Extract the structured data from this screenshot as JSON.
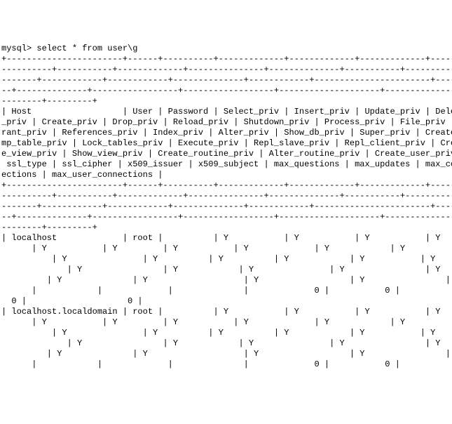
{
  "terminal": {
    "prompt": "mysql> ",
    "command": "select * from user\\g",
    "separator_long": "+-----------------------+------+----------+-------------+-------------+-------------+-------------+---",
    "separator_cont1": "----------+-----------+-------------+---------------+--------------+-----------+------------+--------",
    "separator_cont2": "-------+------------+------------+--------------+------------+-----------------------+----------------",
    "separator_cont3": "--+--------------+-----------------+------------------+--------------------+--------------------+----",
    "separator_cont4": "--------+---------+",
    "header_row1": "| Host                  | User | Password | Select_priv | Insert_priv | Update_priv | Delete",
    "header_row2": "_priv | Create_priv | Drop_priv | Reload_priv | Shutdown_priv | Process_priv | File_priv | G",
    "header_row3": "rant_priv | References_priv | Index_priv | Alter_priv | Show_db_priv | Super_priv | Create_t",
    "header_row4": "mp_table_priv | Lock_tables_priv | Execute_priv | Repl_slave_priv | Repl_client_priv | Creat",
    "header_row5": "e_view_priv | Show_view_priv | Create_routine_priv | Alter_routine_priv | Create_user_priv |",
    "header_row6": " ssl_type | ssl_cipher | x509_issuer | x509_subject | max_questions | max_updates | max_conn",
    "header_row7": "ections | max_user_connections |",
    "data_row1_1": "| localhost             | root |          | Y           | Y           | Y           | Y     ",
    "data_row1_2": "      | Y           | Y         | Y           | Y             | Y            | Y           | Y",
    "data_row1_3": "          | Y               | Y          | Y          | Y            | Y           | Y        ",
    "data_row1_4": "             | Y                | Y            | Y               | Y                | Y       ",
    "data_row1_5": "         | Y              | Y                   | Y                  | Y                |    ",
    "data_row1_6": "      |            |             |              |             0 |           0 |             ",
    "data_row1_7": "  0 |                    0 |",
    "data_row2_1": "| localhost.localdomain | root |          | Y           | Y           | Y           | Y     ",
    "data_row2_2": "      | Y           | Y         | Y           | Y             | Y            | Y           | Y",
    "data_row2_3": "          | Y               | Y          | Y          | Y            | Y           | Y        ",
    "data_row2_4": "             | Y                | Y            | Y               | Y                | Y       ",
    "data_row2_5": "         | Y              | Y                   | Y                  | Y                |    ",
    "data_row2_6": "      |            |             |              |             0 |           0 |             "
  }
}
